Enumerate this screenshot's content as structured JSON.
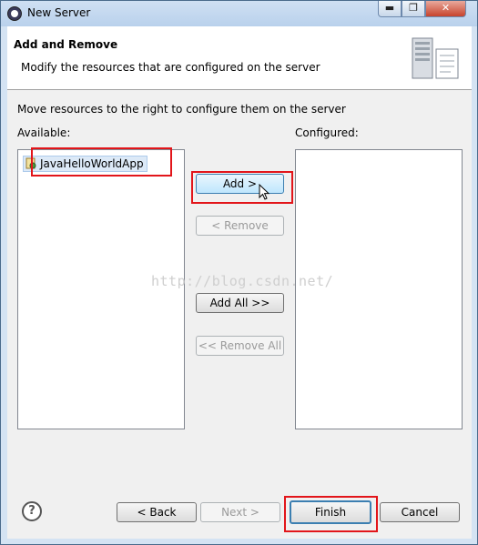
{
  "window": {
    "title": "New Server",
    "min_glyph": "▬",
    "max_glyph": "❐",
    "close_glyph": "✕"
  },
  "banner": {
    "title": "Add and Remove",
    "description": "Modify the resources that are configured on the server"
  },
  "content": {
    "instruction": "Move resources to the right to configure them on the server",
    "available_label": "Available:",
    "configured_label": "Configured:",
    "available_items": [
      "JavaHelloWorldApp"
    ],
    "configured_items": []
  },
  "buttons": {
    "add": "Add >",
    "remove": "< Remove",
    "add_all": "Add All >>",
    "remove_all": "<< Remove All"
  },
  "footer": {
    "help": "?",
    "back": "< Back",
    "next": "Next >",
    "finish": "Finish",
    "cancel": "Cancel"
  },
  "watermark": "http://blog.csdn.net/",
  "colors": {
    "highlight": "#e2151a",
    "accent": "#3c7fb1"
  }
}
